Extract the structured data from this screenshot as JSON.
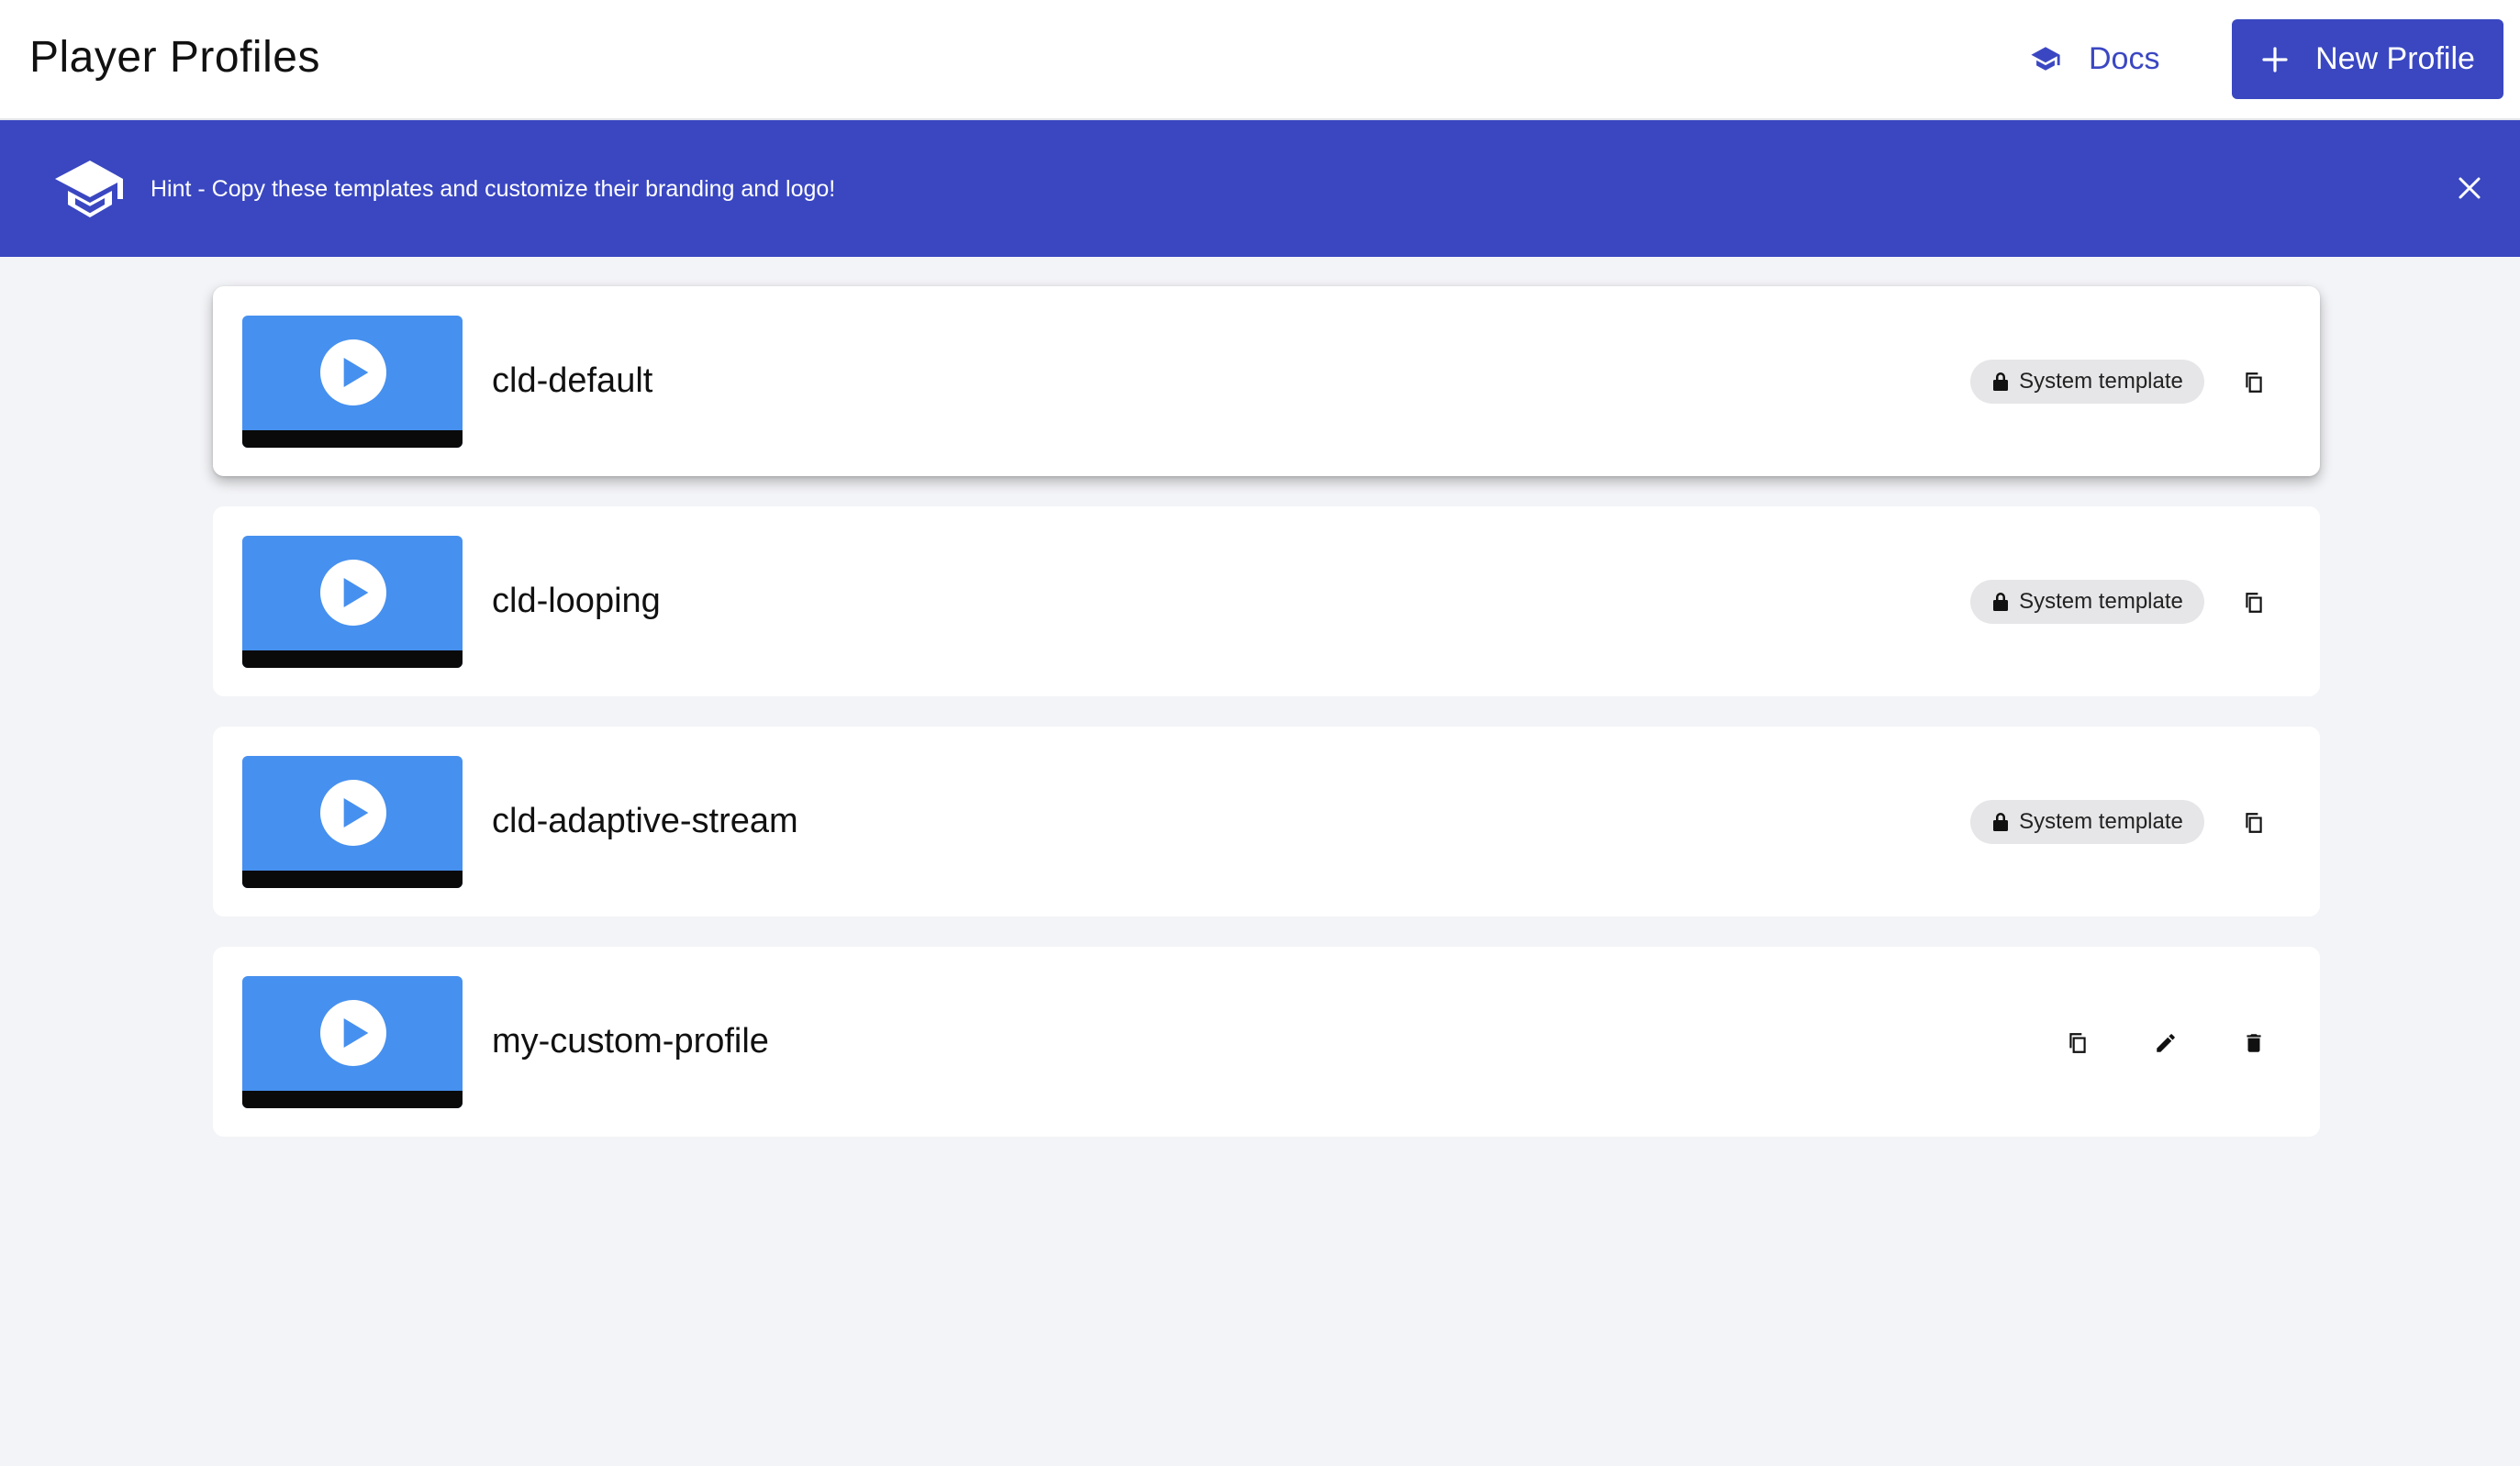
{
  "header": {
    "title": "Player Profiles",
    "docs_label": "Docs",
    "docs_icon": "graduation-cap-icon",
    "new_button_label": "New Profile",
    "new_button_icon": "plus-icon"
  },
  "banner": {
    "icon": "graduation-cap-icon",
    "text": "Hint - Copy these templates and customize their branding and logo!",
    "close_icon": "close-icon"
  },
  "colors": {
    "accent": "#3a47c1",
    "thumbnail": "#4690ef",
    "chip_bg": "#e6e6e8",
    "page_bg": "#f3f4f7"
  },
  "profiles": [
    {
      "name": "cld-default",
      "badge": "System template",
      "actions": [
        "copy"
      ]
    },
    {
      "name": "cld-looping",
      "badge": "System template",
      "actions": [
        "copy"
      ]
    },
    {
      "name": "cld-adaptive-stream",
      "badge": "System template",
      "actions": [
        "copy"
      ]
    },
    {
      "name": "my-custom-profile",
      "badge": "",
      "actions": [
        "copy",
        "edit",
        "delete"
      ]
    }
  ]
}
